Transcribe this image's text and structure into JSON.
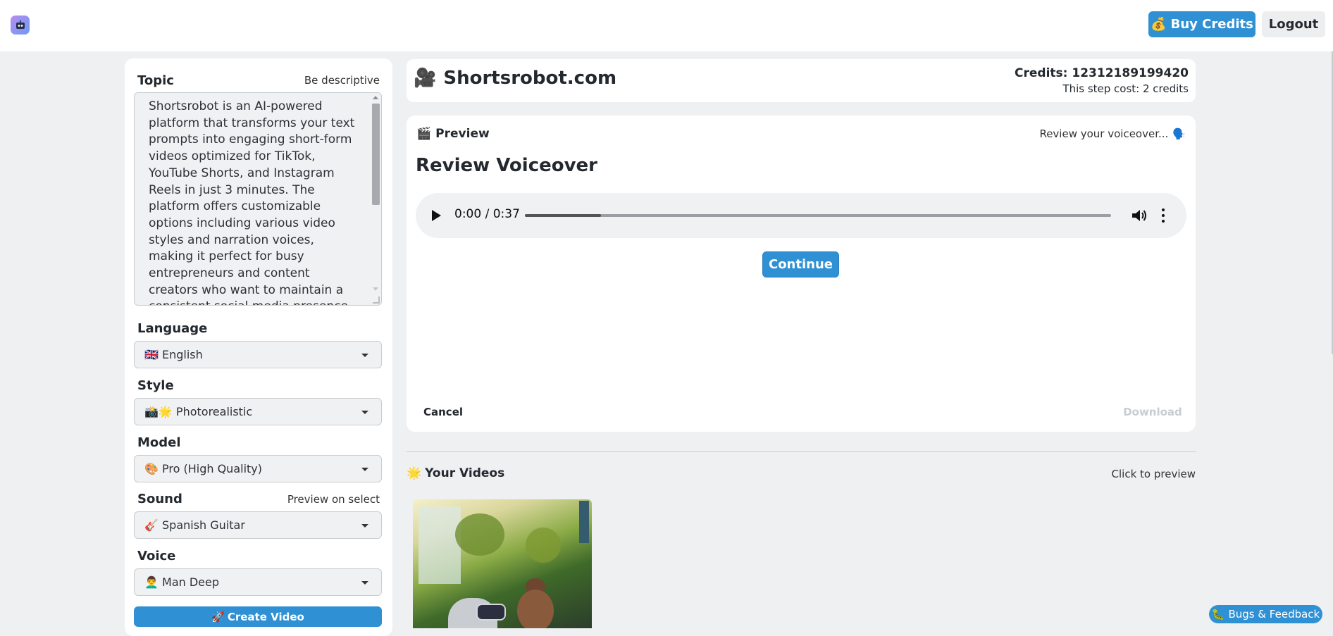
{
  "topbar": {
    "buy_credits_icon": "💰",
    "buy_credits_label": "Buy Credits",
    "logout_label": "Logout"
  },
  "form": {
    "topic_label": "Topic",
    "topic_hint": "Be descriptive",
    "topic_value": "Shortsrobot is an AI-powered platform that transforms your text prompts into engaging short-form videos optimized for TikTok, YouTube Shorts, and Instagram Reels in just 3 minutes. The platform offers customizable options including various video styles and narration voices, making it perfect for busy entrepreneurs and content creators who want to maintain a consistent social media presence. With flexible pricing",
    "language_label": "Language",
    "language_value": "🇬🇧 English",
    "style_label": "Style",
    "style_value": "📸🌟 Photorealistic",
    "model_label": "Model",
    "model_value": "🎨 Pro (High Quality)",
    "sound_label": "Sound",
    "sound_hint": "Preview on select",
    "sound_value": "🎸 Spanish Guitar",
    "voice_label": "Voice",
    "voice_value": "👨‍🦱 Man Deep",
    "create_icon": "🚀",
    "create_label": "Create Video"
  },
  "header": {
    "site_icon": "🎥",
    "site_title": "Shortsrobot.com",
    "credits_text": "Credits: 12312189199420",
    "step_cost_text": "This step cost: 2 credits"
  },
  "preview": {
    "head_icon": "🎬",
    "head_label": "Preview",
    "note_text": "Review your voiceover...",
    "note_icon": "🗣️",
    "title": "Review Voiceover",
    "audio_time": "0:00 / 0:37",
    "audio_progress_fraction": 0.13,
    "continue_label": "Continue",
    "cancel_label": "Cancel",
    "download_label": "Download"
  },
  "videos": {
    "head_icon": "🌟",
    "head_label": "Your Videos",
    "note_text": "Click to preview"
  },
  "feedback": {
    "icon": "🐛",
    "label": "Bugs & Feedback"
  },
  "colors": {
    "accent": "#3090d4",
    "page_bg": "#eef0f2",
    "card_bg": "#ffffff"
  }
}
